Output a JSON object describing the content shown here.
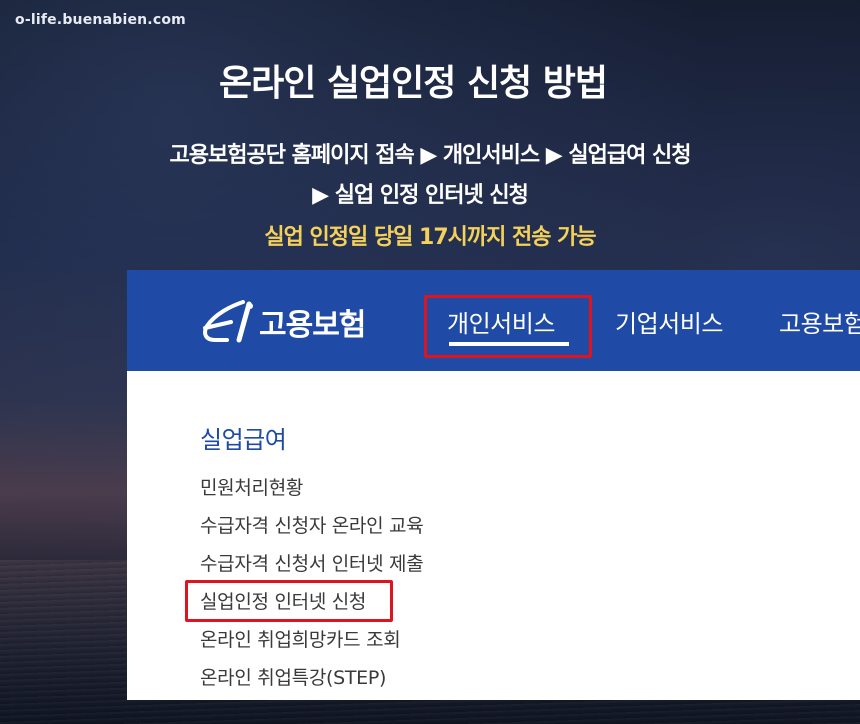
{
  "watermark": "o-life.buenabien.com",
  "headline": "온라인 실업인정 신청 방법",
  "steps_line1": "고용보험공단 홈페이지 접속 ▶ 개인서비스 ▶ 실업급여 신청",
  "steps_line2": "▶ 실업 인정 인터넷 신청",
  "note": "실업 인정일 당일 17시까지 전송 가능",
  "colors": {
    "nav_background": "#1f4aa6",
    "highlight_border": "#e0141e",
    "note_text": "#f4d15a"
  },
  "site": {
    "logo_text": "고용보험",
    "logo_icon": "ei-logo-icon",
    "nav": [
      {
        "label": "개인서비스",
        "active": true,
        "highlighted": true
      },
      {
        "label": "기업서비스",
        "active": false,
        "highlighted": false
      },
      {
        "label": "고용보험",
        "active": false,
        "highlighted": false
      }
    ],
    "section_title": "실업급여",
    "menu": [
      {
        "label": "민원처리현황",
        "highlighted": false
      },
      {
        "label": "수급자격 신청자 온라인 교육",
        "highlighted": false
      },
      {
        "label": "수급자격 신청서 인터넷 제출",
        "highlighted": false
      },
      {
        "label": "실업인정 인터넷 신청",
        "highlighted": true
      },
      {
        "label": "온라인 취업희망카드 조회",
        "highlighted": false
      },
      {
        "label": "온라인 취업특강(STEP)",
        "highlighted": false
      }
    ]
  }
}
